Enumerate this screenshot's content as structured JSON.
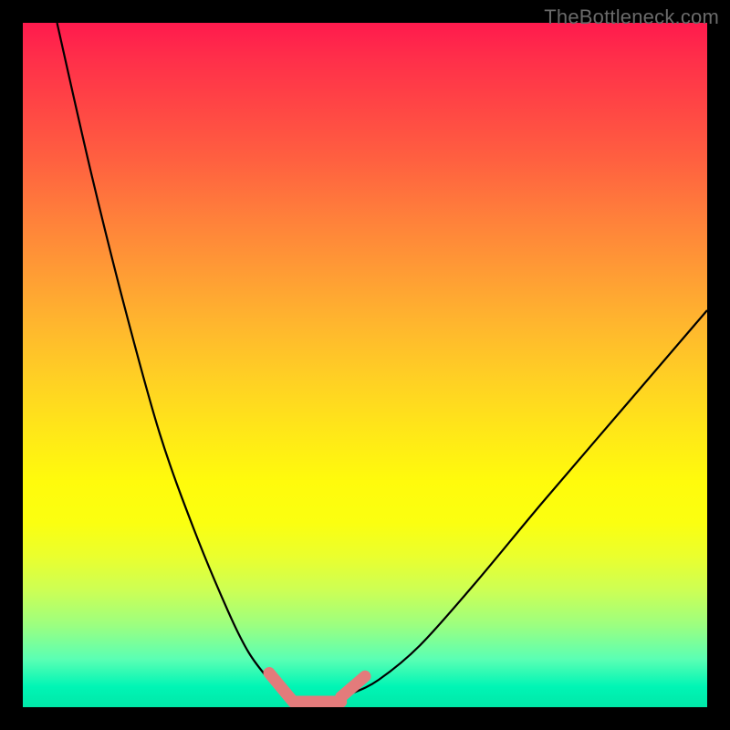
{
  "watermark": "TheBottleneck.com",
  "chart_data": {
    "type": "line",
    "title": "",
    "xlabel": "",
    "ylabel": "",
    "xlim": [
      0,
      100
    ],
    "ylim": [
      0,
      100
    ],
    "grid": false,
    "background": {
      "style": "vertical-gradient",
      "stops": [
        {
          "pos": 0,
          "color": "#ff1a4d"
        },
        {
          "pos": 50,
          "color": "#ffd024"
        },
        {
          "pos": 75,
          "color": "#fbff10"
        },
        {
          "pos": 100,
          "color": "#00e8a8"
        }
      ]
    },
    "series": [
      {
        "name": "curve",
        "color": "#000000",
        "x": [
          5,
          10,
          15,
          20,
          25,
          30,
          33,
          36,
          38,
          39.5,
          41,
          44,
          46,
          48,
          52,
          58,
          66,
          76,
          88,
          100
        ],
        "y": [
          100,
          78,
          58,
          40,
          26,
          14,
          8,
          4,
          2,
          1,
          1,
          1,
          1.5,
          2,
          4,
          9,
          18,
          30,
          44,
          58
        ],
        "note": "V-shaped curve; flat minimum segment roughly x in [39.5, 46] at y≈0"
      },
      {
        "name": "highlight-marker",
        "color": "#e37b7b",
        "thickness": 13,
        "segments": [
          {
            "x": [
              36,
              39.5
            ],
            "y": [
              5,
              0.8
            ]
          },
          {
            "x": [
              39.5,
              46.5
            ],
            "y": [
              0.8,
              0.8
            ]
          },
          {
            "x": [
              46.5,
              50
            ],
            "y": [
              1.5,
              4.5
            ]
          }
        ],
        "note": "thick rounded salmon overlay tracing the bottom of the V (descent, flat, ascent)"
      }
    ]
  }
}
